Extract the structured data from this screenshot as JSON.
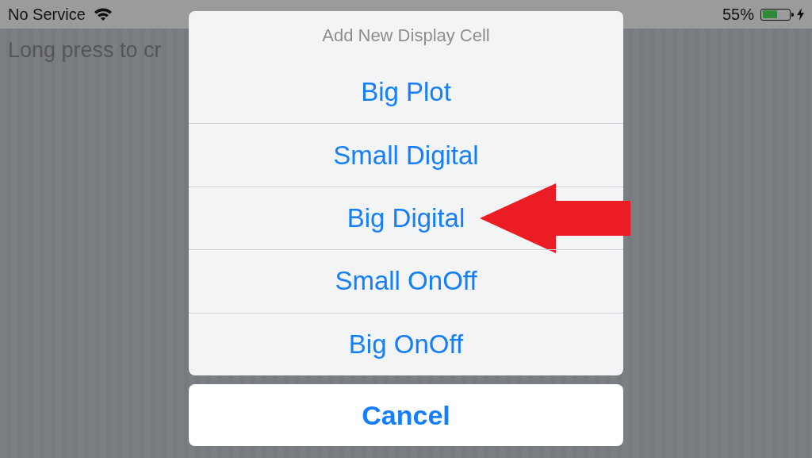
{
  "status_bar": {
    "carrier": "No Service",
    "battery": "55%",
    "charging": true
  },
  "background": {
    "hint": "Long press to cr"
  },
  "action_sheet": {
    "title": "Add New Display Cell",
    "options": [
      {
        "label": "Big Plot",
        "highlighted": false
      },
      {
        "label": "Small Digital",
        "highlighted": false
      },
      {
        "label": "Big Digital",
        "highlighted": true
      },
      {
        "label": "Small OnOff",
        "highlighted": false
      },
      {
        "label": "Big OnOff",
        "highlighted": false
      }
    ],
    "cancel": "Cancel"
  }
}
